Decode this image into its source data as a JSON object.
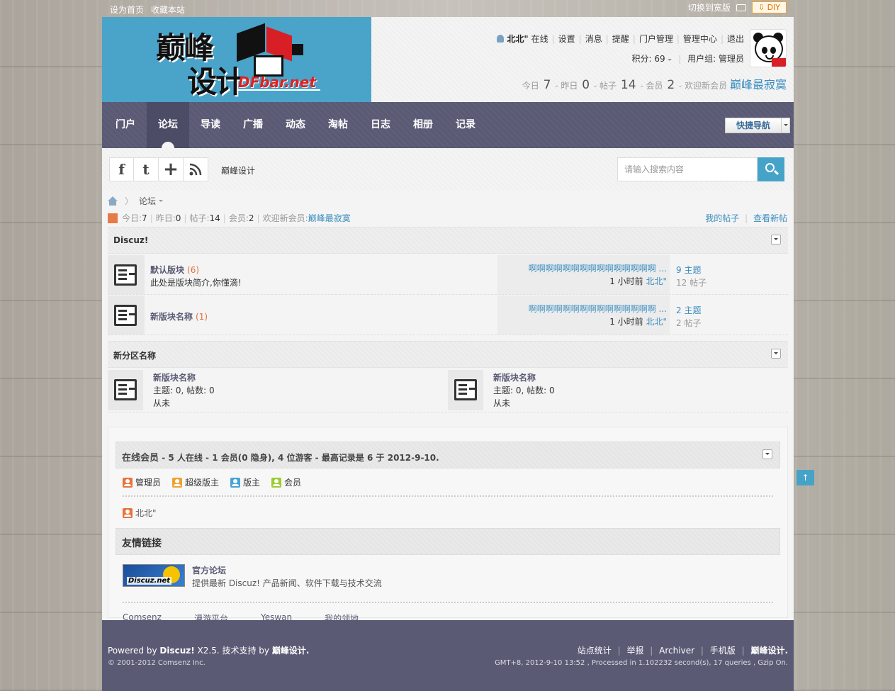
{
  "topbar": {
    "set_home": "设为首页",
    "bookmark": "收藏本站",
    "switch_wide": "切换到宽版",
    "diy": "DIY"
  },
  "header": {
    "logo_text_1": "巅峰",
    "logo_text_2": "设计",
    "logo_domain": "DFbar.net",
    "username": "北北\"",
    "online": "在线",
    "links": [
      "设置",
      "消息",
      "提醒",
      "门户管理",
      "管理中心",
      "退出"
    ],
    "points_label": "积分: 69",
    "usergroup": "用户组: 管理员",
    "stats": {
      "today_label": "今日",
      "today": "7",
      "yesterday_label": "昨日",
      "yesterday": "0",
      "posts_label": "帖子",
      "posts": "14",
      "members_label": "会员",
      "members": "2",
      "welcome": "欢迎新会员",
      "newest": "巅峰最寂寞"
    }
  },
  "nav": {
    "items": [
      "门户",
      "论坛",
      "导读",
      "广播",
      "动态",
      "淘帖",
      "日志",
      "相册",
      "记录"
    ],
    "active": "论坛",
    "quicknav": "快捷导航"
  },
  "subbar": {
    "social": [
      "f",
      "t",
      "+",
      "rss"
    ],
    "sitename": "巅峰设计",
    "search_placeholder": "请输入搜索内容"
  },
  "main": {
    "breadcrumb": "论坛",
    "stats": {
      "today": "今日: ",
      "today_v": "7",
      "yesterday": "昨日: ",
      "yesterday_v": "0",
      "posts": "帖子: ",
      "posts_v": "14",
      "members": "会员: ",
      "members_v": "2",
      "welcome": "欢迎新会员: ",
      "newest": "巅峰最寂寞"
    },
    "my_posts": "我的帖子",
    "new_posts": "查看新帖",
    "category1": {
      "title": "Discuz!",
      "forums": [
        {
          "name": "默认版块",
          "count": "(6)",
          "desc": "此处是版块简介,你懂滴!",
          "last_title": "啊啊啊啊啊啊啊啊啊啊啊啊啊啊啊 ...",
          "last_time": "1 小时前",
          "last_user": "北北\"",
          "threads": "9 主题",
          "posts": "12 帖子"
        },
        {
          "name": "新版块名称",
          "count": "(1)",
          "desc": "",
          "last_title": "啊啊啊啊啊啊啊啊啊啊啊啊啊啊啊 ...",
          "last_time": "1 小时前",
          "last_user": "北北\"",
          "threads": "2 主题",
          "posts": "2 帖子"
        }
      ]
    },
    "category2": {
      "title": "新分区名称",
      "forums": [
        {
          "name": "新版块名称",
          "stats": "主题: 0, 帖数: 0",
          "last": "从未"
        },
        {
          "name": "新版块名称",
          "stats": "主题: 0, 帖数: 0",
          "last": "从未"
        }
      ]
    }
  },
  "online": {
    "title": "在线会员",
    "summary": " - 5 人在线 - 1 会员(0 隐身), 4 位游客 - 最高记录是 6 于 2012-9-10.",
    "legend": [
      {
        "label": "管理员",
        "color": "#e8743c"
      },
      {
        "label": "超级版主",
        "color": "#f0a030"
      },
      {
        "label": "版主",
        "color": "#46a3d8"
      },
      {
        "label": "会员",
        "color": "#9acd32"
      }
    ],
    "user": "北北\""
  },
  "links": {
    "title": "友情链接",
    "image_label": "Discuz.net",
    "name": "官方论坛",
    "desc": "提供最新 Discuz! 产品新闻、软件下载与技术交流",
    "text_links": [
      "Comsenz",
      "漫游平台",
      "Yeswan",
      "我的领地"
    ]
  },
  "back_top": "↑",
  "footer": {
    "powered": "Powered by",
    "product": "Discuz!",
    "version": " X2.5. 技术支持 by ",
    "author": "巅峰设计.",
    "copyright": "© 2001-2012 Comsenz Inc.",
    "links": [
      "站点统计",
      "举报",
      "Archiver",
      "手机版",
      "巅峰设计."
    ],
    "info": "GMT+8, 2012-9-10 13:52 , Processed in 1.102232 second(s), 17 queries , Gzip On."
  }
}
